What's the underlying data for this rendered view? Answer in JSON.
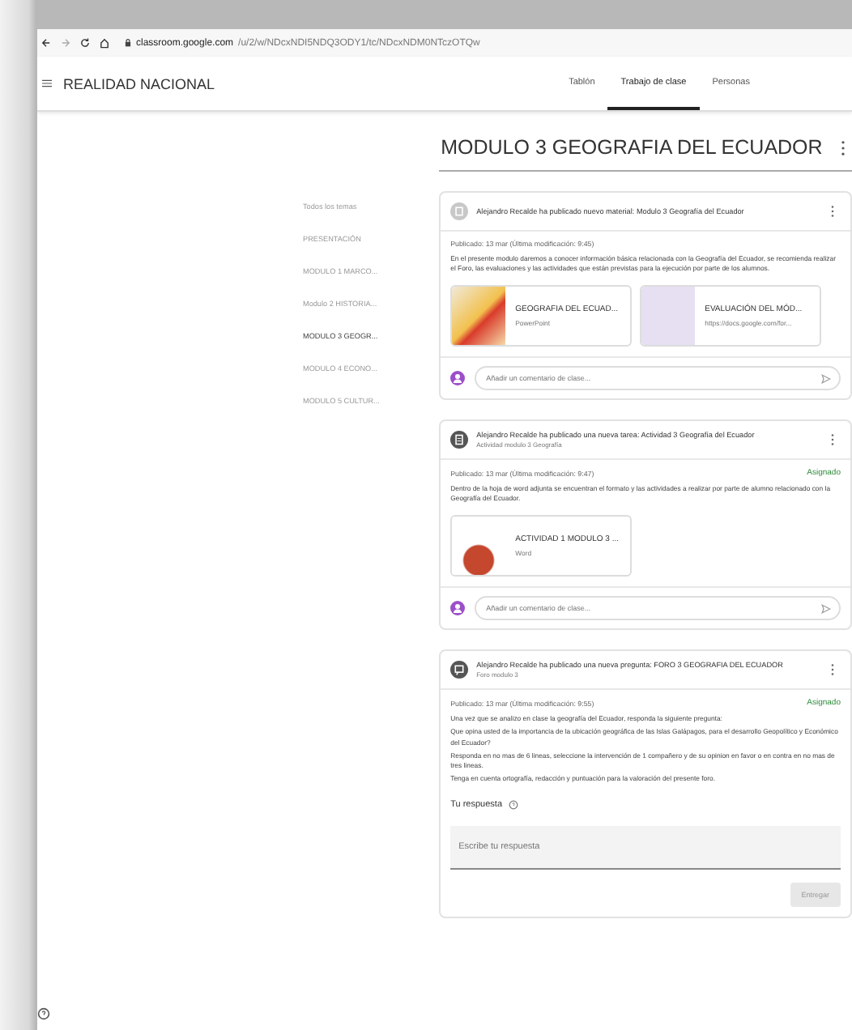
{
  "browser": {
    "url_host": "classroom.google.com",
    "url_path": "/u/2/w/NDcxNDI5NDQ3ODY1/tc/NDcxNDM0NTczOTQw"
  },
  "header": {
    "course": "REALIDAD NACIONAL"
  },
  "tabs": [
    {
      "label": "Tablón",
      "selected": false
    },
    {
      "label": "Trabajo de clase",
      "selected": true
    },
    {
      "label": "Personas",
      "selected": false
    }
  ],
  "topics": [
    {
      "label": "Todos los temas",
      "selected": false
    },
    {
      "label": "PRESENTACIÓN",
      "selected": false
    },
    {
      "label": "MODULO 1 MARCO...",
      "selected": false
    },
    {
      "label": "Modulo 2 HISTORIA...",
      "selected": false
    },
    {
      "label": "MODULO 3 GEOGR...",
      "selected": true
    },
    {
      "label": "MODULO 4 ECONO...",
      "selected": false
    },
    {
      "label": "MODULO 5 CULTUR...",
      "selected": false
    }
  ],
  "topic_title": "MODULO 3 GEOGRAFIA DEL ECUADOR",
  "posts": [
    {
      "kind": "material",
      "title": "Alejandro Recalde ha publicado nuevo material: Modulo 3 Geografía del Ecuador",
      "published": "Publicado: 13 mar (Última modificación: 9:45)",
      "body": [
        "En el presente modulo daremos a conocer información básica relacionada con la Geografía del Ecuador, se recomienda realizar el Foro, las evaluaciones y las actividades que están previstas para la ejecución por parte de los alumnos."
      ],
      "attachments": [
        {
          "kind": "slides",
          "name": "GEOGRAFIA DEL ECUAD...",
          "type": "PowerPoint"
        },
        {
          "kind": "form",
          "name": "EVALUACIÓN DEL MÓD...",
          "type": "https://docs.google.com/for..."
        }
      ],
      "comment_placeholder": "Añadir un comentario de clase..."
    },
    {
      "kind": "assignment",
      "title": "Alejandro Recalde ha publicado una nueva tarea: Actividad 3 Geografía del Ecuador",
      "subtitle": "Actividad modulo 3 Geografía",
      "published": "Publicado: 13 mar (Última modificación: 9:47)",
      "status": "Asignado",
      "body": [
        "Dentro de la hoja de word adjunta se encuentran el formato y las actividades a realizar por parte de alumno relacionado con la Geografía del Ecuador."
      ],
      "attachments": [
        {
          "kind": "doc",
          "name": "ACTIVIDAD 1 MODULO 3 ...",
          "type": "Word"
        }
      ],
      "comment_placeholder": "Añadir un comentario de clase..."
    },
    {
      "kind": "question",
      "title": "Alejandro Recalde ha publicado una nueva pregunta: FORO 3 GEOGRAFIA DEL ECUADOR",
      "subtitle": "Foro modulo 3",
      "published": "Publicado: 13 mar (Última modificación: 9:55)",
      "status": "Asignado",
      "body": [
        "Una vez que se analizo en clase la geografía del Ecuador, responda la siguiente pregunta:",
        "Que opina usted de la importancia de la ubicación geográfica de las Islas Galápagos, para el desarrollo Geopolítico y Económico del Ecuador?",
        "Responda en no mas de 6 lineas, seleccione la intervención de 1 compañero y de su opinion en favor o en contra en no mas de tres lineas.",
        "Tenga en cuenta ortografía, redacción y puntuación para la valoración del presente foro."
      ],
      "answer_label": "Tu respuesta",
      "answer_placeholder": "Escribe tu respuesta",
      "submit": {
        "label": "Entregar",
        "disabled": true
      }
    }
  ]
}
